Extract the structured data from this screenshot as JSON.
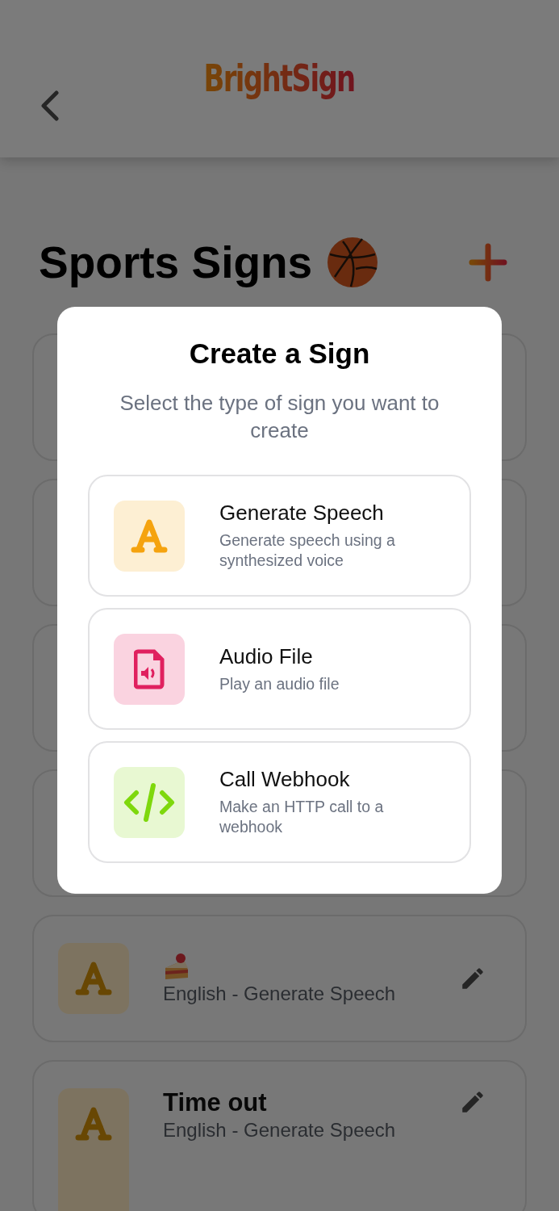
{
  "header": {
    "logo": "BrightSign"
  },
  "page": {
    "title": "Sports Signs"
  },
  "signs": [
    {
      "kind": "covered"
    },
    {
      "kind": "covered"
    },
    {
      "kind": "covered"
    },
    {
      "kind": "covered"
    },
    {
      "kind": "emoji-title",
      "subtitle": "English - Generate Speech"
    },
    {
      "kind": "text-title",
      "title": "Time out",
      "subtitle": "English - Generate Speech"
    }
  ],
  "modal": {
    "title": "Create a Sign",
    "subtitle": "Select the type of sign you want to create",
    "options": [
      {
        "kind": "speech",
        "title": "Generate Speech",
        "description": "Generate speech using a synthesized voice"
      },
      {
        "kind": "audio",
        "title": "Audio File",
        "description": "Play an audio file"
      },
      {
        "kind": "webhook",
        "title": "Call Webhook",
        "description": "Make an HTTP call to a webhook"
      }
    ]
  }
}
